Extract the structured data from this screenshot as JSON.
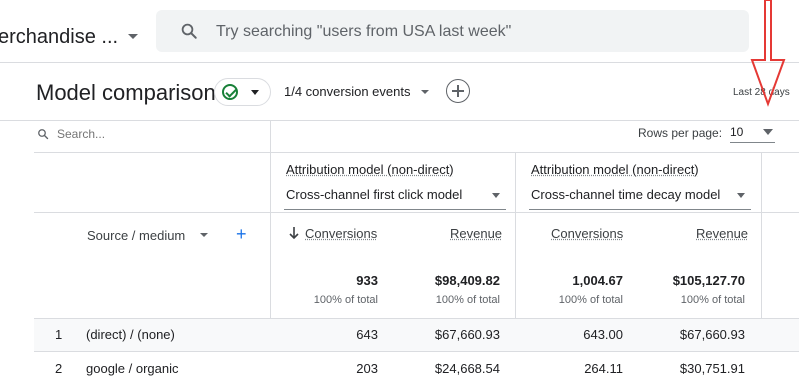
{
  "header": {
    "property_name": "erchandise ...",
    "search_placeholder": "Try searching \"users from USA last week\""
  },
  "toolbar": {
    "title": "Model comparison",
    "conversion_events": "1/4 conversion events",
    "date_range": "Last 28 days"
  },
  "table_controls": {
    "search_placeholder": "Search...",
    "rows_per_page_label": "Rows per page:",
    "rows_per_page_value": "10"
  },
  "models": [
    {
      "label": "Attribution model (non-direct)",
      "selected": "Cross-channel first click model"
    },
    {
      "label": "Attribution model (non-direct)",
      "selected": "Cross-channel time decay model"
    }
  ],
  "columns": {
    "dimension": "Source / medium",
    "conversions": "Conversions",
    "revenue": "Revenue"
  },
  "totals": [
    {
      "conversions": "933",
      "revenue": "$98,409.82",
      "conv_pct": "100% of total",
      "rev_pct": "100% of total"
    },
    {
      "conversions": "1,004.67",
      "revenue": "$105,127.70",
      "conv_pct": "100% of total",
      "rev_pct": "100% of total"
    }
  ],
  "rows": [
    {
      "index": "1",
      "dimension": "(direct) / (none)",
      "m1_conversions": "643",
      "m1_revenue": "$67,660.93",
      "m2_conversions": "643.00",
      "m2_revenue": "$67,660.93"
    },
    {
      "index": "2",
      "dimension": "google / organic",
      "m1_conversions": "203",
      "m1_revenue": "$24,668.54",
      "m2_conversions": "264.11",
      "m2_revenue": "$30,751.91"
    }
  ],
  "icons": [
    "search-icon",
    "check-circle-icon",
    "add-icon",
    "arrow-down-icon",
    "caret-down-icon"
  ],
  "colors": {
    "accent": "#1a73e8",
    "success": "#188038",
    "annotation": "#e53935"
  }
}
